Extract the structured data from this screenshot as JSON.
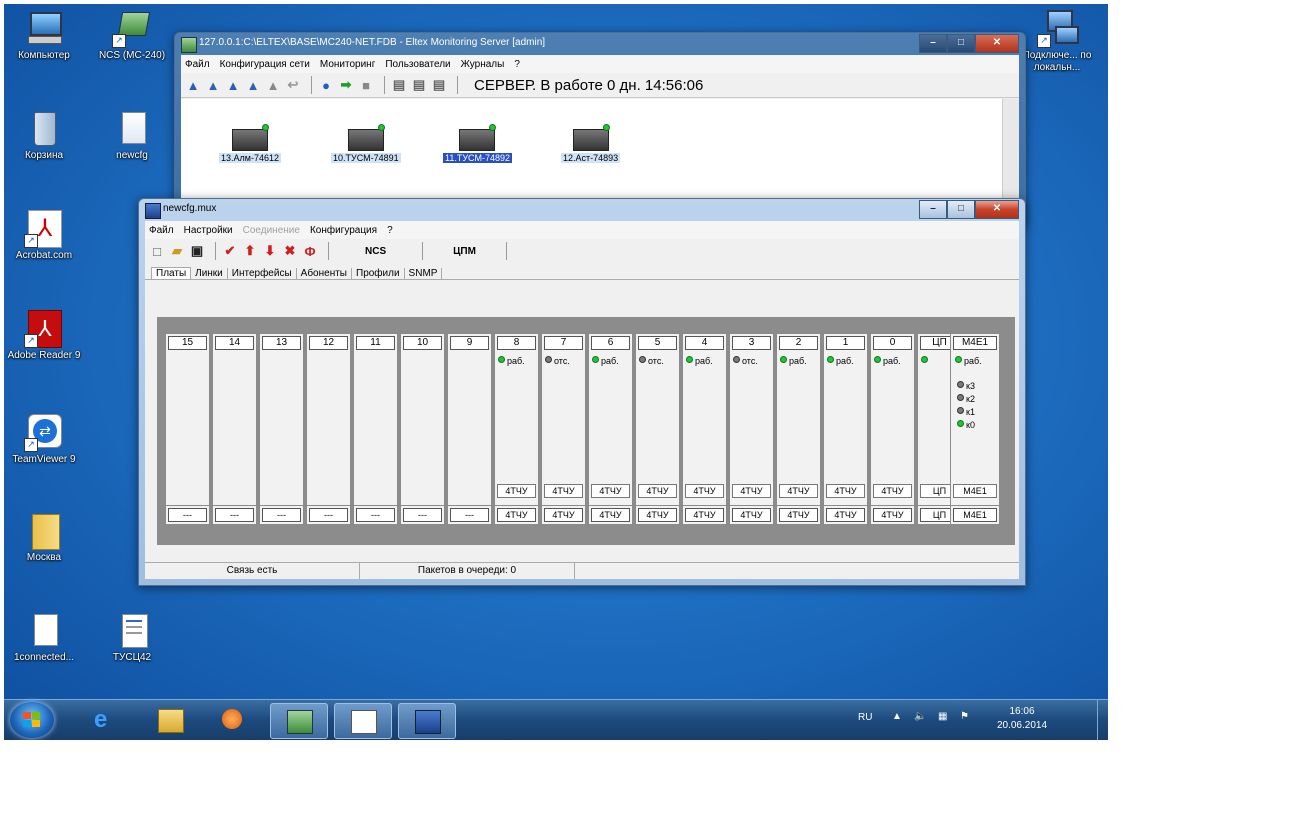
{
  "desktop": {
    "icons_left": [
      {
        "label": "Компьютер",
        "icon": "computer-icon"
      },
      {
        "label": "Корзина",
        "icon": "recycle-bin-icon"
      },
      {
        "label": "Acrobat.com",
        "icon": "acrobat-com-icon"
      },
      {
        "label": "Adobe Reader 9",
        "icon": "adobe-reader-icon"
      },
      {
        "label": "TeamViewer 9",
        "icon": "teamviewer-icon"
      },
      {
        "label": "Москва",
        "icon": "folder-icon"
      },
      {
        "label": "1connected...",
        "icon": "file-icon"
      }
    ],
    "icons_second": [
      {
        "label": "NCS (MC-240)",
        "icon": "ncs-shortcut-icon"
      },
      {
        "label": "newcfg",
        "icon": "newcfg-file-icon"
      },
      {
        "label": "ТУСЦ42",
        "icon": "document-icon"
      }
    ],
    "icon_right": {
      "label": "Подключе... по локальн...",
      "icon": "network-connection-icon"
    }
  },
  "monitor_window": {
    "title": "127.0.0.1:C:\\ELTEX\\BASE\\MC240-NET.FDB - Eltex Monitoring Server [admin]",
    "menu": [
      "Файл",
      "Конфигурация сети",
      "Мониторинг",
      "Пользователи",
      "Журналы",
      "?"
    ],
    "status_text": "СЕРВЕР. В работе 0 дн. 14:56:06",
    "devices": [
      {
        "label": "13.Алм-74612",
        "selected": false
      },
      {
        "label": "10.ТУСМ-74891",
        "selected": false
      },
      {
        "label": "11.ТУСМ-74892",
        "selected": true
      },
      {
        "label": "12.Аст-74893",
        "selected": false
      }
    ]
  },
  "mux_window": {
    "title": "newcfg.mux",
    "menu": [
      {
        "label": "Файл",
        "disabled": false
      },
      {
        "label": "Настройки",
        "disabled": false
      },
      {
        "label": "Соединение",
        "disabled": true
      },
      {
        "label": "Конфигурация",
        "disabled": false
      },
      {
        "label": "?",
        "disabled": false
      }
    ],
    "toolbar_text_buttons": [
      "NCS",
      "ЦПМ"
    ],
    "tabs": [
      "Платы",
      "Линки",
      "Интерфейсы",
      "Абоненты",
      "Профили",
      "SNMP"
    ],
    "active_tab": "Платы",
    "slots": [
      {
        "num": "15",
        "status": "",
        "dot": "",
        "type_top": "",
        "type_bottom": "---"
      },
      {
        "num": "14",
        "status": "",
        "dot": "",
        "type_top": "",
        "type_bottom": "---"
      },
      {
        "num": "13",
        "status": "",
        "dot": "",
        "type_top": "",
        "type_bottom": "---"
      },
      {
        "num": "12",
        "status": "",
        "dot": "",
        "type_top": "",
        "type_bottom": "---"
      },
      {
        "num": "11",
        "status": "",
        "dot": "",
        "type_top": "",
        "type_bottom": "---"
      },
      {
        "num": "10",
        "status": "",
        "dot": "",
        "type_top": "",
        "type_bottom": "---"
      },
      {
        "num": "9",
        "status": "",
        "dot": "",
        "type_top": "",
        "type_bottom": "---"
      },
      {
        "num": "8",
        "status": "раб.",
        "dot": "g",
        "type_top": "4ТЧУ",
        "type_bottom": "4ТЧУ"
      },
      {
        "num": "7",
        "status": "отс.",
        "dot": "k",
        "type_top": "4ТЧУ",
        "type_bottom": "4ТЧУ"
      },
      {
        "num": "6",
        "status": "раб.",
        "dot": "g",
        "type_top": "4ТЧУ",
        "type_bottom": "4ТЧУ"
      },
      {
        "num": "5",
        "status": "отс.",
        "dot": "k",
        "type_top": "4ТЧУ",
        "type_bottom": "4ТЧУ"
      },
      {
        "num": "4",
        "status": "раб.",
        "dot": "g",
        "type_top": "4ТЧУ",
        "type_bottom": "4ТЧУ"
      },
      {
        "num": "3",
        "status": "отс.",
        "dot": "k",
        "type_top": "4ТЧУ",
        "type_bottom": "4ТЧУ"
      },
      {
        "num": "2",
        "status": "раб.",
        "dot": "g",
        "type_top": "4ТЧУ",
        "type_bottom": "4ТЧУ"
      },
      {
        "num": "1",
        "status": "раб.",
        "dot": "g",
        "type_top": "4ТЧУ",
        "type_bottom": "4ТЧУ"
      },
      {
        "num": "0",
        "status": "раб.",
        "dot": "g",
        "type_top": "4ТЧУ",
        "type_bottom": "4ТЧУ"
      },
      {
        "num": "ЦП",
        "status": "",
        "dot": "g",
        "type_top": "ЦП",
        "type_bottom": "ЦП"
      }
    ],
    "m4e1": {
      "num": "М4Е1",
      "status": "раб.",
      "ports": [
        {
          "label": "к3",
          "dot": "k"
        },
        {
          "label": "к2",
          "dot": "k"
        },
        {
          "label": "к1",
          "dot": "k"
        },
        {
          "label": "к0",
          "dot": "g"
        }
      ],
      "type_top": "М4Е1",
      "type_bottom": "М4Е1"
    },
    "statusbar": [
      "Связь есть",
      "Пакетов в очереди: 0"
    ]
  },
  "taskbar": {
    "tray": {
      "lang": "RU",
      "time": "16:06",
      "date": "20.06.2014"
    }
  }
}
